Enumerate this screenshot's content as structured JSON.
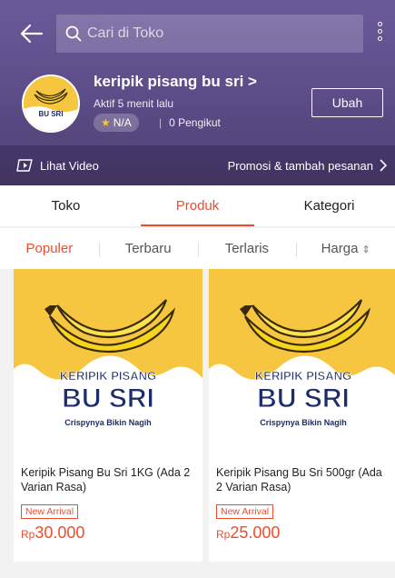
{
  "header": {
    "search_placeholder": "Cari di Toko"
  },
  "shop": {
    "name": "keripik pisang bu sri >",
    "active_status": "Aktif 5 menit lalu",
    "rating": "N/A",
    "followers": "0 Pengikut",
    "edit_label": "Ubah",
    "logo_text": "BU SRI"
  },
  "video_bar": {
    "video_label": "Lihat Video",
    "promo_label": "Promosi & tambah pesanan"
  },
  "tabs": [
    {
      "label": "Toko",
      "active": false
    },
    {
      "label": "Produk",
      "active": true
    },
    {
      "label": "Kategori",
      "active": false
    }
  ],
  "sort": [
    {
      "label": "Populer",
      "active": true
    },
    {
      "label": "Terbaru",
      "active": false
    },
    {
      "label": "Terlaris",
      "active": false
    },
    {
      "label": "Harga",
      "active": false
    }
  ],
  "products": [
    {
      "title": "Keripik Pisang Bu Sri 1KG (Ada 2 Varian Rasa)",
      "badge": "New Arrival",
      "currency": "Rp",
      "price": "30.000",
      "img_line1": "KERIPIK PISANG",
      "img_line2": "BU SRI",
      "img_tagline": "Crispynya Bikin Nagih"
    },
    {
      "title": "Keripik Pisang Bu Sri 500gr (Ada 2 Varian Rasa)",
      "badge": "New Arrival",
      "currency": "Rp",
      "price": "25.000",
      "img_line1": "KERIPIK PISANG",
      "img_line2": "BU SRI",
      "img_tagline": "Crispynya Bikin Nagih"
    }
  ],
  "colors": {
    "accent": "#ee4d2d",
    "header_bg": "#5b4b86",
    "banana_yellow": "#f6c640"
  },
  "icons": {
    "back": "back-arrow-icon",
    "search": "search-icon",
    "more": "more-vertical-icon",
    "star": "star-icon",
    "video": "play-video-icon",
    "chevron": "chevron-right-icon",
    "sort": "sort-arrows-icon"
  }
}
